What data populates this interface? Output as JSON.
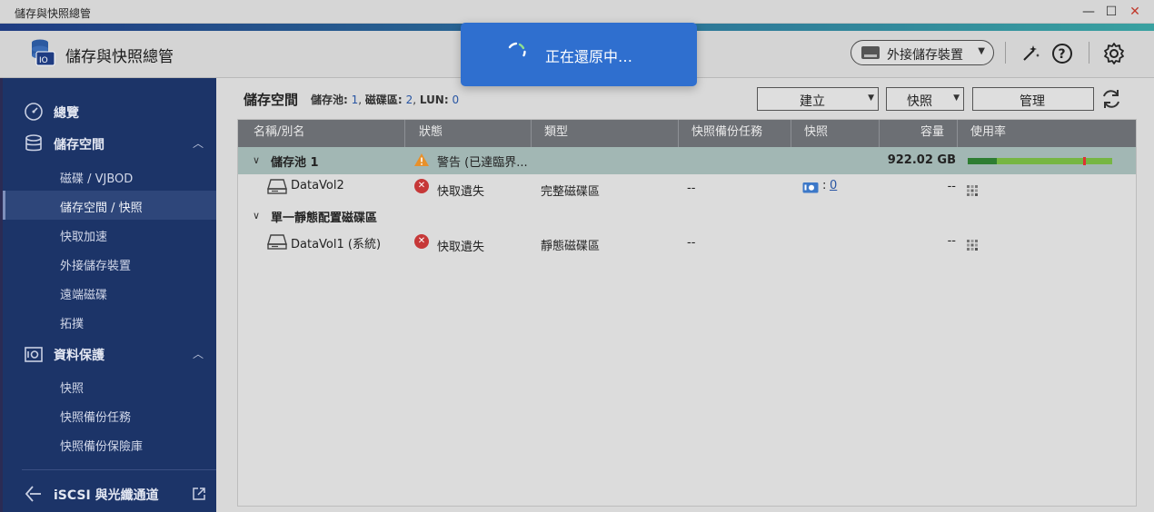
{
  "window": {
    "title": "儲存與快照總管",
    "minimize": "—",
    "maximize": "☐",
    "close": "✕"
  },
  "header": {
    "app_title": "儲存與快照總管",
    "external_storage_button": "外接儲存裝置",
    "icons": [
      "wand-icon",
      "help-icon",
      "gear-icon"
    ]
  },
  "toast": {
    "message": "正在還原中…"
  },
  "sidebar": {
    "overview": "總覽",
    "storage": {
      "label": "儲存空間",
      "items": [
        "磁碟 / VJBOD",
        "儲存空間 / 快照",
        "快取加速",
        "外接儲存裝置",
        "遠端磁碟",
        "拓撲"
      ],
      "active_index": 1
    },
    "data_protection": {
      "label": "資料保護",
      "items": [
        "快照",
        "快照備份任務",
        "快照備份保險庫"
      ]
    },
    "iscsi": "iSCSI 與光纖通道"
  },
  "main": {
    "summary": {
      "title": "儲存空間",
      "pool_label": "儲存池:",
      "pool_count": "1",
      "volume_label": "磁碟區:",
      "volume_count": "2",
      "lun_label": "LUN:",
      "lun_count": "0"
    },
    "toolbar": {
      "create": "建立",
      "snapshot": "快照",
      "manage": "管理"
    },
    "table": {
      "columns": [
        "名稱/別名",
        "狀態",
        "類型",
        "快照備份任務",
        "快照",
        "容量",
        "使用率"
      ],
      "rows": {
        "pool1": {
          "name": "儲存池 1",
          "status": "警告 (已達臨界...",
          "capacity": "922.02 GB",
          "usage_fraction": 0.2,
          "threshold_fraction": 0.8
        },
        "vol2": {
          "name": "DataVol2",
          "status": "快取遺失",
          "type": "完整磁碟區",
          "backup_jobs": "--",
          "snapshot_prefix": ":",
          "snapshot_count": "0",
          "capacity": "--"
        },
        "static_group": {
          "name": "單一靜態配置磁碟區"
        },
        "vol1": {
          "name": "DataVol1 (系統)",
          "status": "快取遺失",
          "type": "靜態磁碟區",
          "backup_jobs": "--",
          "capacity": "--"
        }
      }
    }
  },
  "colors": {
    "sidebar_bg": "#1c3468",
    "toast_bg": "#2f6fcf",
    "pool_row_bg": "#a2b7b4",
    "usage_green": "#76b643",
    "usage_dark": "#2e7d32",
    "error_red": "#c63838",
    "warning_orange": "#e8902a"
  }
}
